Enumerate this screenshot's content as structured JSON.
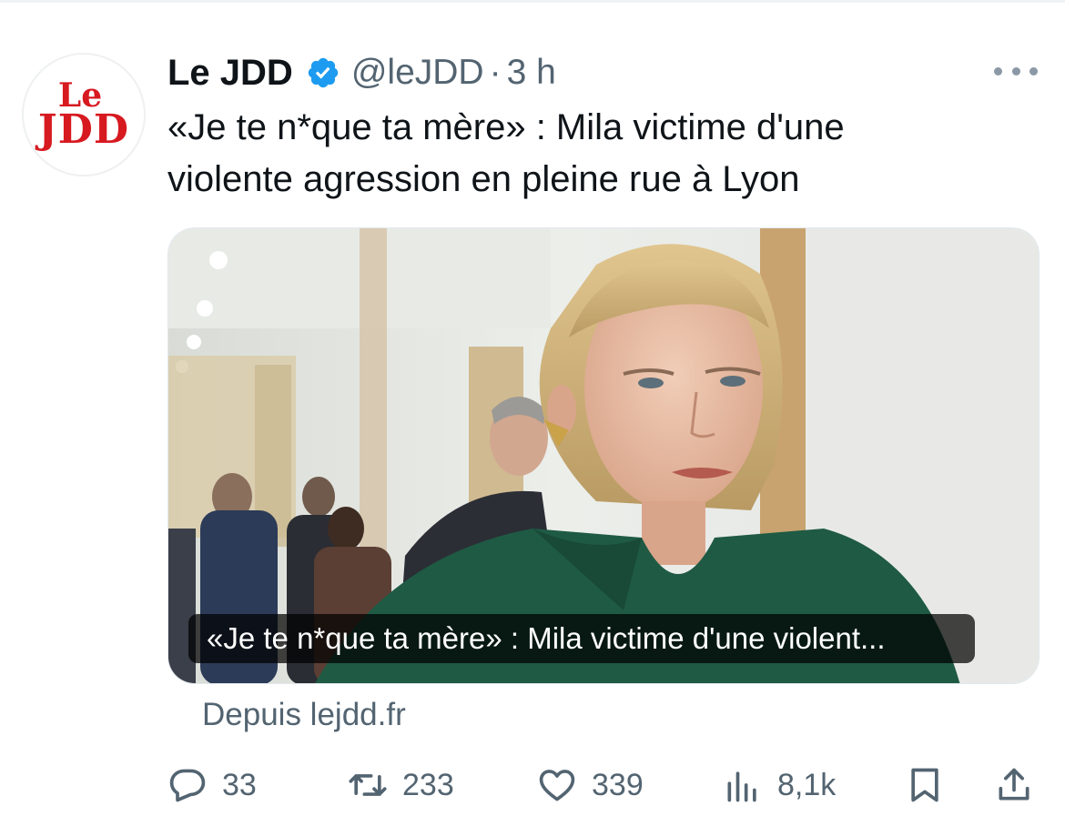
{
  "account": {
    "name": "Le JDD",
    "handle": "@leJDD",
    "separator": "·",
    "time": "3 h",
    "avatar_text_line1": "Le",
    "avatar_text_line2": "JDD",
    "verified_color": "#1d9bf0"
  },
  "tweet": {
    "text_line1": "«Je te n*que ta mère» : Mila victime d'une",
    "text_line2": "violente agression en pleine rue à Lyon"
  },
  "card": {
    "caption": "«Je te n*que ta mère» : Mila victime d'une violent...",
    "source": "Depuis lejdd.fr"
  },
  "actions": {
    "replies": "33",
    "retweets": "233",
    "likes": "339",
    "views": "8,1k"
  },
  "icons": {
    "more": "more-dots-icon",
    "reply": "reply-bubble-icon",
    "retweet": "retweet-arrows-icon",
    "like": "heart-icon",
    "views": "views-bars-icon",
    "bookmark": "bookmark-icon",
    "share": "share-upload-icon"
  },
  "colors": {
    "text_primary": "#0f1419",
    "text_secondary": "#536471",
    "brand_red": "#d71920"
  }
}
